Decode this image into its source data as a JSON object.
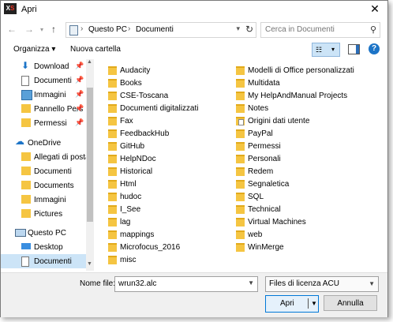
{
  "window": {
    "title": "Apri",
    "app_icon_text": "XS"
  },
  "navbar": {
    "breadcrumb": [
      "Questo PC",
      "Documenti"
    ],
    "search_placeholder": "Cerca in Documenti"
  },
  "toolbar": {
    "organize": "Organizza",
    "new_folder": "Nuova cartella"
  },
  "nav_items": [
    {
      "label": "Download",
      "icon": "download-icon",
      "pinned": true
    },
    {
      "label": "Documenti",
      "icon": "documents-icon",
      "pinned": true
    },
    {
      "label": "Immagini",
      "icon": "pictures-icon",
      "pinned": true
    },
    {
      "label": "Pannello Pers",
      "icon": "folder-icon",
      "pinned": true
    },
    {
      "label": "Permessi",
      "icon": "folder-icon",
      "pinned": true
    },
    {
      "label": "OneDrive",
      "icon": "onedrive-icon",
      "pinned": false
    },
    {
      "label": "Allegati di posta",
      "icon": "folder-icon",
      "pinned": false
    },
    {
      "label": "Documenti",
      "icon": "folder-icon",
      "pinned": false
    },
    {
      "label": "Documents",
      "icon": "folder-icon",
      "pinned": false
    },
    {
      "label": "Immagini",
      "icon": "folder-icon",
      "pinned": false
    },
    {
      "label": "Pictures",
      "icon": "folder-icon",
      "pinned": false
    },
    {
      "label": "Questo PC",
      "icon": "computer-icon",
      "pinned": false
    },
    {
      "label": "Desktop",
      "icon": "desktop-icon",
      "pinned": false
    },
    {
      "label": "Documenti",
      "icon": "documents-icon",
      "pinned": false,
      "selected": true
    }
  ],
  "files_col1": [
    "Audacity",
    "Books",
    "CSE-Toscana",
    "Documenti digitalizzati",
    "Fax",
    "FeedbackHub",
    "GitHub",
    "HelpNDoc",
    "Historical",
    "Html",
    "hudoc",
    "I_See",
    "lag",
    "mappings",
    "Microfocus_2016",
    "misc"
  ],
  "files_col2": [
    "Modelli di Office personalizzati",
    "Multidata",
    "My HelpAndManual Projects",
    "Notes",
    "Origini dati utente",
    "PayPal",
    "Permessi",
    "Personali",
    "Redem",
    "Segnaletica",
    "SQL",
    "Technical",
    "Virtual Machines",
    "web",
    "WinMerge"
  ],
  "bottom": {
    "filename_label": "Nome file:",
    "filename_value": "wrun32.alc",
    "filetype_value": "Files di licenza ACU",
    "open_label": "Apri",
    "cancel_label": "Annulla"
  }
}
